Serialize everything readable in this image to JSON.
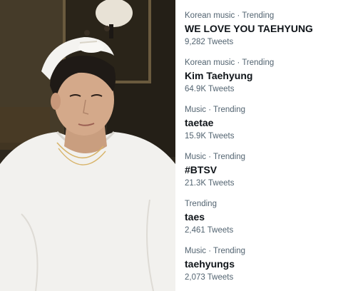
{
  "photo": {
    "icon": "portrait-photo"
  },
  "trends": [
    {
      "context": "Korean music · Trending",
      "name": "WE LOVE YOU TAEHYUNG",
      "count": "9,282 Tweets"
    },
    {
      "context": "Korean music · Trending",
      "name": "Kim Taehyung",
      "count": "64.9K Tweets"
    },
    {
      "context": "Music · Trending",
      "name": "taetae",
      "count": "15.9K Tweets"
    },
    {
      "context": "Music · Trending",
      "name": "#BTSV",
      "count": "21.3K Tweets"
    },
    {
      "context": "Trending",
      "name": "taes",
      "count": "2,461 Tweets"
    },
    {
      "context": "Music · Trending",
      "name": "taehyungs",
      "count": "2,073 Tweets"
    }
  ]
}
